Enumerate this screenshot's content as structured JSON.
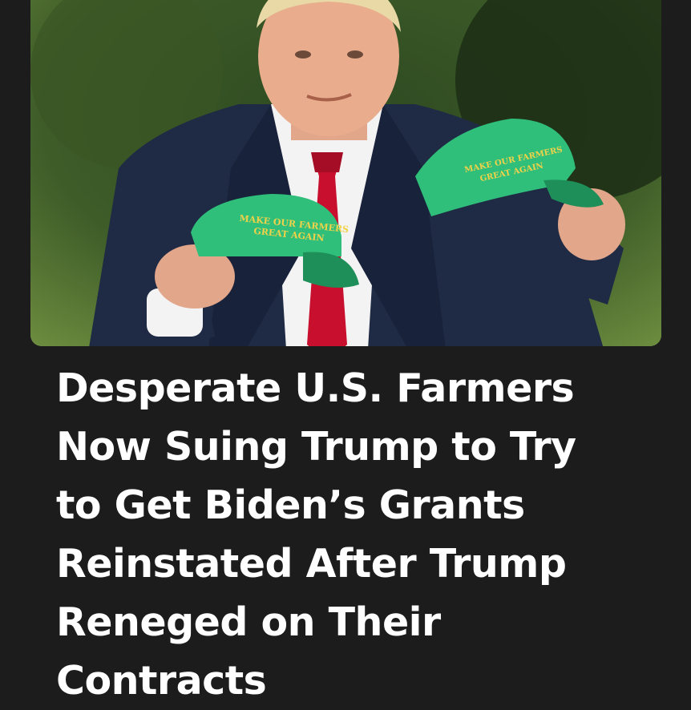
{
  "post": {
    "image": {
      "subject_icon": "man-holding-hats",
      "hat_left_text": "MAKE OUR FARMERS GREAT AGAIN",
      "hat_right_text": "MAKE OUR FARMERS GREAT AGAIN"
    },
    "headline_lines": [
      "Desperate U.S. Farmers",
      "Now Suing Trump to Try",
      "to Get Biden’s Grants",
      "Reinstated After Trump",
      "Reneged on Their",
      "Contracts"
    ]
  },
  "colors": {
    "background": "#1c1c1c",
    "text": "#ffffff",
    "hat_green": "#2fbf7a",
    "tie_red": "#c8102e",
    "suit_navy": "#1f2a44"
  }
}
